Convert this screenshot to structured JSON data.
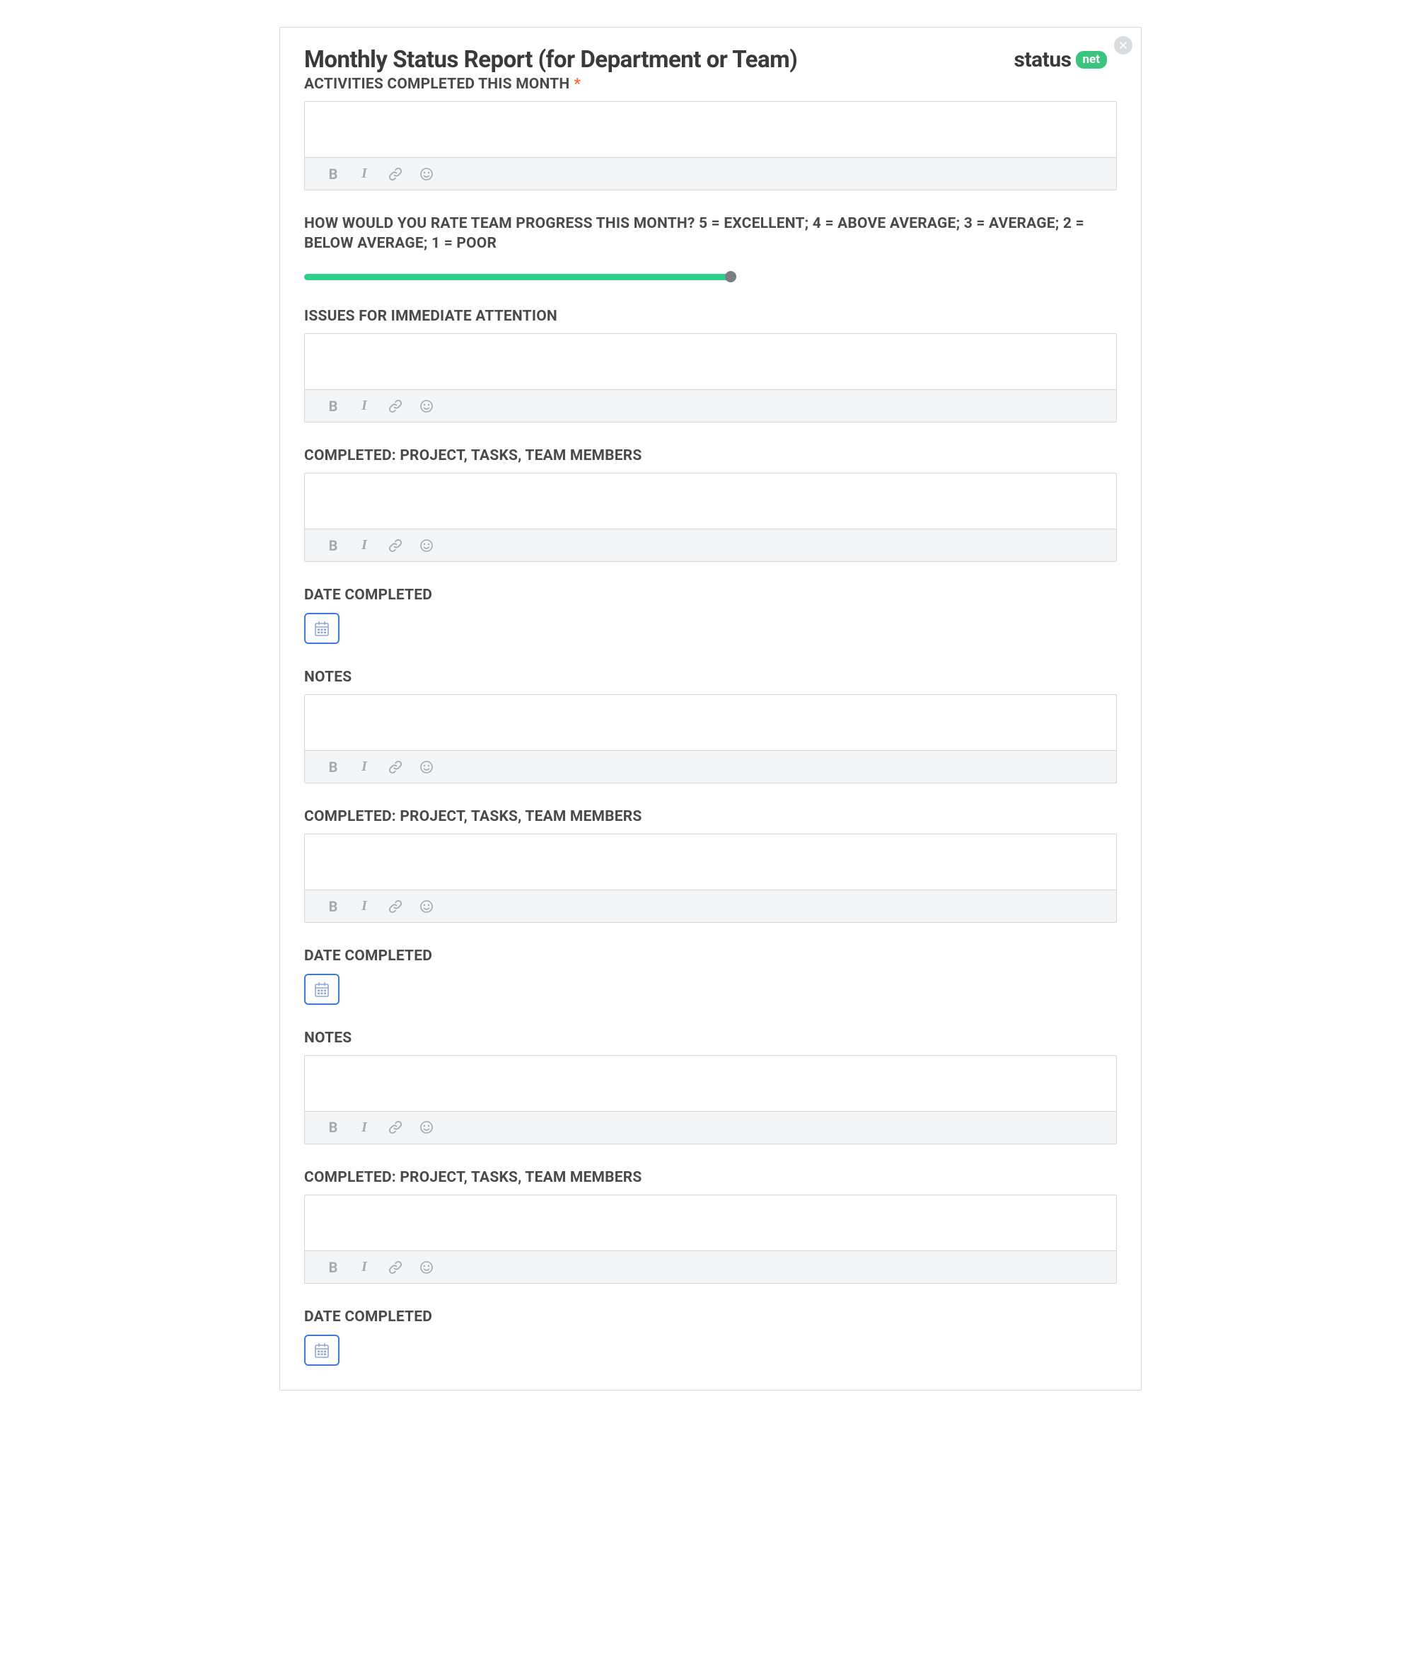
{
  "header": {
    "title": "Monthly Status Report (for Department or Team)",
    "logo_text": "status",
    "logo_badge": "net"
  },
  "slider": {
    "percent": 52.5
  },
  "sections": [
    {
      "id": "activities",
      "label": "ACTIVITIES COMPLETED THIS MONTH",
      "required": true,
      "type": "richtext"
    },
    {
      "id": "rating",
      "label": "HOW WOULD YOU RATE TEAM PROGRESS THIS MONTH? 5 = EXCELLENT; 4 = ABOVE AVERAGE; 3 = AVERAGE; 2 = BELOW AVERAGE; 1 = POOR",
      "type": "slider"
    },
    {
      "id": "issues",
      "label": "ISSUES FOR IMMEDIATE ATTENTION",
      "type": "richtext"
    },
    {
      "id": "completed-1",
      "label": "COMPLETED: PROJECT, TASKS, TEAM MEMBERS",
      "type": "richtext"
    },
    {
      "id": "date-1",
      "label": "DATE COMPLETED",
      "type": "date"
    },
    {
      "id": "notes-1",
      "label": "NOTES",
      "type": "richtext"
    },
    {
      "id": "completed-2",
      "label": "COMPLETED: PROJECT, TASKS, TEAM MEMBERS",
      "type": "richtext"
    },
    {
      "id": "date-2",
      "label": "DATE COMPLETED",
      "type": "date"
    },
    {
      "id": "notes-2",
      "label": "NOTES",
      "type": "richtext"
    },
    {
      "id": "completed-3",
      "label": "COMPLETED: PROJECT, TASKS, TEAM MEMBERS",
      "type": "richtext"
    },
    {
      "id": "date-3",
      "label": "DATE COMPLETED",
      "type": "date"
    }
  ],
  "toolbar_icons": {
    "bold": "B",
    "italic": "I"
  }
}
